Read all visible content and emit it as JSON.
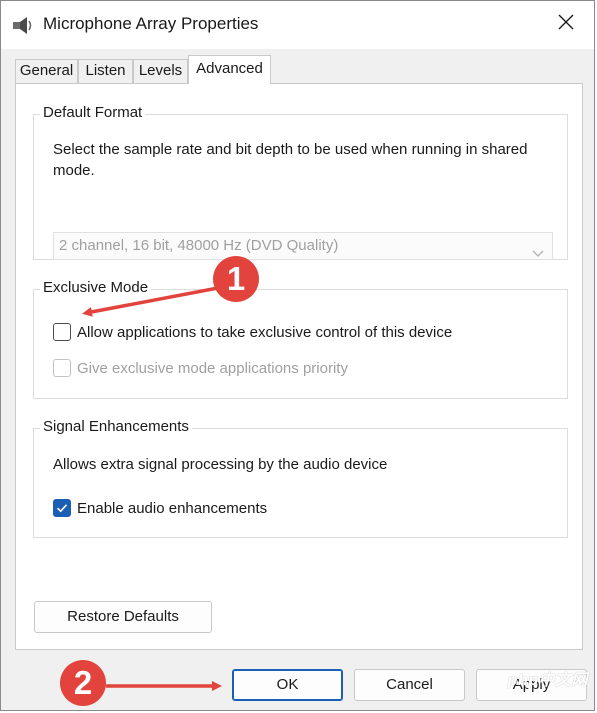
{
  "window": {
    "title": "Microphone Array Properties",
    "icon": "microphone-icon",
    "close_icon": "close-icon"
  },
  "tabs": [
    {
      "label": "General",
      "active": false
    },
    {
      "label": "Listen",
      "active": false
    },
    {
      "label": "Levels",
      "active": false
    },
    {
      "label": "Advanced",
      "active": true
    }
  ],
  "default_format": {
    "legend": "Default Format",
    "description": "Select the sample rate and bit depth to be used when running in shared mode.",
    "dropdown_value": "2 channel, 16 bit, 48000 Hz (DVD Quality)"
  },
  "exclusive_mode": {
    "legend": "Exclusive Mode",
    "allow_label": "Allow applications to take exclusive control of this device",
    "allow_checked": false,
    "priority_label": "Give exclusive mode applications priority",
    "priority_checked": false
  },
  "signal_enhancements": {
    "legend": "Signal Enhancements",
    "description": "Allows extra signal processing by the audio device",
    "enable_label": "Enable audio enhancements",
    "enable_checked": true
  },
  "buttons": {
    "restore_defaults": "Restore Defaults",
    "ok": "OK",
    "cancel": "Cancel",
    "apply": "Apply"
  },
  "annotations": {
    "marker_1": "1",
    "marker_2": "2",
    "color": "#e2443d"
  },
  "watermark": "php中文网",
  "colors": {
    "accent": "#1a5fb4",
    "annotation": "#e2443d"
  }
}
